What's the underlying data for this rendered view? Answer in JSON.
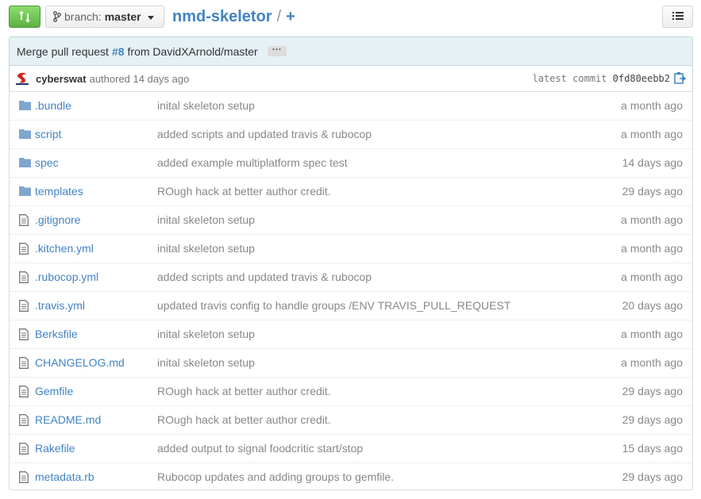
{
  "header": {
    "branch_prefix": "branch:",
    "branch_name": "master",
    "repo_name": "nmd-skeletor",
    "separator": "/",
    "plus": "+"
  },
  "commit": {
    "title_prefix": "Merge pull request",
    "pr_number": "#8",
    "title_suffix": "from DavidXArnold/master",
    "ellipsis": "···",
    "author": "cyberswat",
    "authored_text": "authored 14 days ago",
    "latest_label": "latest commit",
    "sha": "0fd80eebb2"
  },
  "files": [
    {
      "type": "dir",
      "name": ".bundle",
      "message": "inital skeleton setup",
      "age": "a month ago"
    },
    {
      "type": "dir",
      "name": "script",
      "message": "added scripts and updated travis & rubocop",
      "age": "a month ago"
    },
    {
      "type": "dir",
      "name": "spec",
      "message": "added example multiplatform spec test",
      "age": "14 days ago"
    },
    {
      "type": "dir",
      "name": "templates",
      "message": "ROugh hack at better author credit.",
      "age": "29 days ago"
    },
    {
      "type": "file",
      "name": ".gitignore",
      "message": "inital skeleton setup",
      "age": "a month ago"
    },
    {
      "type": "file",
      "name": ".kitchen.yml",
      "message": "inital skeleton setup",
      "age": "a month ago"
    },
    {
      "type": "file",
      "name": ".rubocop.yml",
      "message": "added scripts and updated travis & rubocop",
      "age": "a month ago"
    },
    {
      "type": "file",
      "name": ".travis.yml",
      "message": "updated travis config to handle groups /ENV TRAVIS_PULL_REQUEST",
      "age": "20 days ago"
    },
    {
      "type": "file",
      "name": "Berksfile",
      "message": "inital skeleton setup",
      "age": "a month ago"
    },
    {
      "type": "file",
      "name": "CHANGELOG.md",
      "message": "inital skeleton setup",
      "age": "a month ago"
    },
    {
      "type": "file",
      "name": "Gemfile",
      "message": "ROugh hack at better author credit.",
      "age": "29 days ago"
    },
    {
      "type": "file",
      "name": "README.md",
      "message": "ROugh hack at better author credit.",
      "age": "29 days ago"
    },
    {
      "type": "file",
      "name": "Rakefile",
      "message": "added output to signal foodcritic start/stop",
      "age": "15 days ago"
    },
    {
      "type": "file",
      "name": "metadata.rb",
      "message": "Rubocop updates and adding groups to gemfile.",
      "age": "29 days ago"
    }
  ],
  "colors": {
    "link": "#4183c4",
    "compare_green": "#60b044",
    "commit_header_bg": "#e6f1f6",
    "folder_icon": "#80a6cd",
    "file_icon": "#777777"
  },
  "icons": {
    "compare": "compare-icon",
    "branch": "branch-icon",
    "list": "list-icon",
    "clipboard": "clipboard-icon",
    "directory": "folder-icon",
    "file": "file-icon"
  }
}
